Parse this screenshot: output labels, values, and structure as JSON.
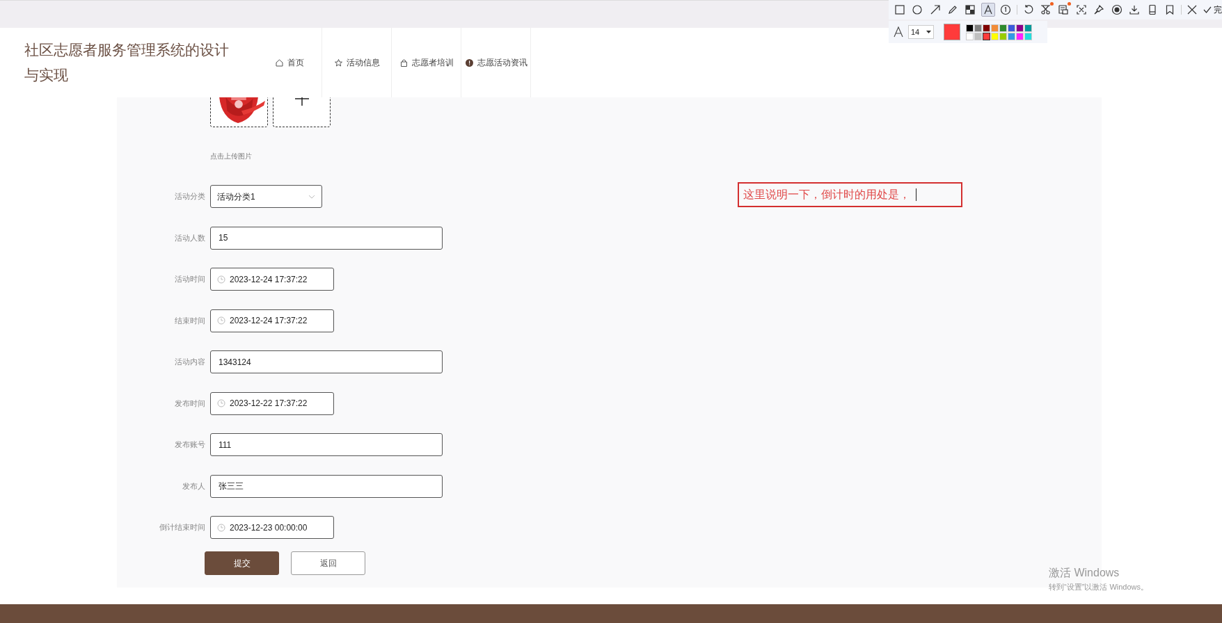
{
  "header": {
    "title": "社区志愿者服务管理系统的设计与实现",
    "nav": [
      {
        "label": "首页",
        "kind": "home"
      },
      {
        "label": "活动信息",
        "kind": "star"
      },
      {
        "label": "志愿者培训",
        "kind": "bag"
      },
      {
        "label": "志愿活动资讯",
        "kind": "alert"
      }
    ]
  },
  "form": {
    "images": [
      {
        "kind": "picture"
      },
      {
        "kind": "add"
      }
    ],
    "upload_hint": "点击上传图片",
    "fields": [
      {
        "label": "活动分类",
        "kind": "select",
        "value": "活动分类1"
      },
      {
        "label": "活动人数",
        "kind": "text",
        "value": "15"
      },
      {
        "label": "活动时间",
        "kind": "datetime",
        "value": "2023-12-24 17:37:22"
      },
      {
        "label": "结束时间",
        "kind": "datetime",
        "value": "2023-12-24 17:37:22"
      },
      {
        "label": "活动内容",
        "kind": "text",
        "value": "1343124"
      },
      {
        "label": "发布时间",
        "kind": "datetime",
        "value": "2023-12-22 17:37:22"
      },
      {
        "label": "发布账号",
        "kind": "text",
        "value": "111"
      },
      {
        "label": "发布人",
        "kind": "text",
        "value": "张三三"
      },
      {
        "label": "倒计结束时间",
        "kind": "datetime",
        "value": "2023-12-23 00:00:00"
      }
    ],
    "buttons": [
      {
        "label": "提交",
        "kind": "primary"
      },
      {
        "label": "返回",
        "kind": "default"
      }
    ]
  },
  "annotation": {
    "text": "这里说明一下，倒计时的用处是，"
  },
  "capture_toolbar": {
    "tools": [
      {
        "kind": "rectangle",
        "selected": false,
        "dot": false
      },
      {
        "kind": "ellipse",
        "selected": false,
        "dot": false
      },
      {
        "kind": "arrow",
        "selected": false,
        "dot": false
      },
      {
        "kind": "pencil",
        "selected": false,
        "dot": false
      },
      {
        "kind": "mosaic",
        "selected": false,
        "dot": false
      },
      {
        "kind": "text",
        "selected": true,
        "dot": false
      },
      {
        "kind": "number",
        "selected": false,
        "dot": false
      },
      {
        "kind": "separator"
      },
      {
        "kind": "undo",
        "selected": false,
        "dot": false
      },
      {
        "kind": "scissors",
        "selected": false,
        "dot": true
      },
      {
        "kind": "ocr",
        "selected": false,
        "dot": true
      },
      {
        "kind": "scan",
        "selected": false,
        "dot": false
      },
      {
        "kind": "pin",
        "selected": false,
        "dot": false
      },
      {
        "kind": "record",
        "selected": false,
        "dot": false
      },
      {
        "kind": "download",
        "selected": false,
        "dot": false
      },
      {
        "kind": "phone",
        "selected": false,
        "dot": false
      },
      {
        "kind": "bookmark",
        "selected": false,
        "dot": false
      },
      {
        "kind": "separator"
      },
      {
        "kind": "close",
        "selected": false,
        "dot": false
      }
    ],
    "done_label": "完",
    "font_size": "14",
    "palette": [
      {
        "color": "#000000",
        "selected": false
      },
      {
        "color": "#808080",
        "selected": false
      },
      {
        "color": "#800000",
        "selected": false
      },
      {
        "color": "#f28c38",
        "selected": false
      },
      {
        "color": "#2e8b2e",
        "selected": false
      },
      {
        "color": "#3b5bdb",
        "selected": false
      },
      {
        "color": "#8b008b",
        "selected": false
      },
      {
        "color": "#009a9a",
        "selected": false
      },
      {
        "color": "#ffffff",
        "selected": false
      },
      {
        "color": "#c0c0c0",
        "selected": false
      },
      {
        "color": "#ff3b3b",
        "selected": true
      },
      {
        "color": "#ffff00",
        "selected": false
      },
      {
        "color": "#99cc00",
        "selected": false
      },
      {
        "color": "#3399e6",
        "selected": false
      },
      {
        "color": "#ff22ff",
        "selected": false
      },
      {
        "color": "#22dddd",
        "selected": false
      }
    ]
  },
  "os_notice": {
    "title": "激活 Windows",
    "text": "转到“设置”以激活 Windows。"
  }
}
